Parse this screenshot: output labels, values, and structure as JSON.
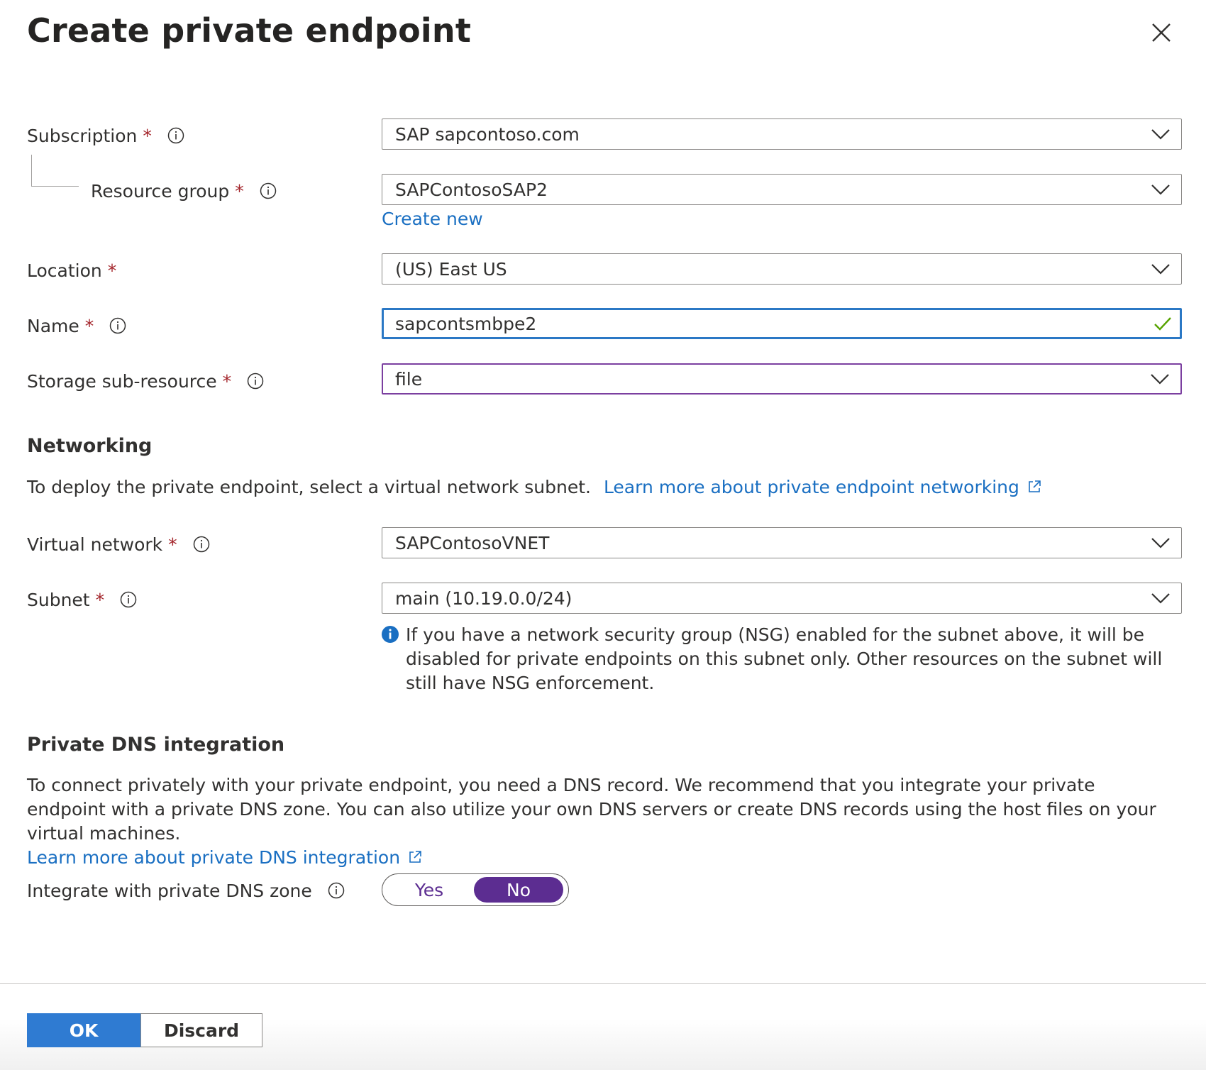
{
  "dialog": {
    "title": "Create private endpoint",
    "close_icon": "close-icon"
  },
  "form": {
    "subscription": {
      "label": "Subscription",
      "required": "*",
      "value": "SAP sapcontoso.com"
    },
    "resource_group": {
      "label": "Resource group",
      "required": "*",
      "value": "SAPContosoSAP2",
      "create_new": "Create new"
    },
    "location": {
      "label": "Location",
      "required": "*",
      "value": "(US) East US"
    },
    "name": {
      "label": "Name",
      "required": "*",
      "value": "sapcontsmbpe2"
    },
    "storage_sub_resource": {
      "label": "Storage sub-resource",
      "required": "*",
      "value": "file"
    }
  },
  "networking": {
    "heading": "Networking",
    "description": "To deploy the private endpoint, select a virtual network subnet.",
    "learn_more": "Learn more about private endpoint networking",
    "virtual_network": {
      "label": "Virtual network",
      "required": "*",
      "value": "SAPContosoVNET"
    },
    "subnet": {
      "label": "Subnet",
      "required": "*",
      "value": "main (10.19.0.0/24)"
    },
    "nsg_info": "If you have a network security group (NSG) enabled for the subnet above, it will be disabled for private endpoints on this subnet only. Other resources on the subnet will still have NSG enforcement."
  },
  "dns": {
    "heading": "Private DNS integration",
    "description": "To connect privately with your private endpoint, you need a DNS record. We recommend that you integrate your private endpoint with a private DNS zone. You can also utilize your own DNS servers or create DNS records using the host files on your virtual machines.",
    "learn_more": "Learn more about private DNS integration",
    "integrate": {
      "label": "Integrate with private DNS zone",
      "yes": "Yes",
      "no": "No",
      "selected": "No"
    }
  },
  "footer": {
    "ok_label": "OK",
    "discard_label": "Discard"
  },
  "colors": {
    "accent_blue": "#2f7bd2",
    "link_blue": "#1a6fc2",
    "toggle_purple": "#5c2d91",
    "required_red": "#a4262c",
    "valid_green": "#57a300"
  }
}
